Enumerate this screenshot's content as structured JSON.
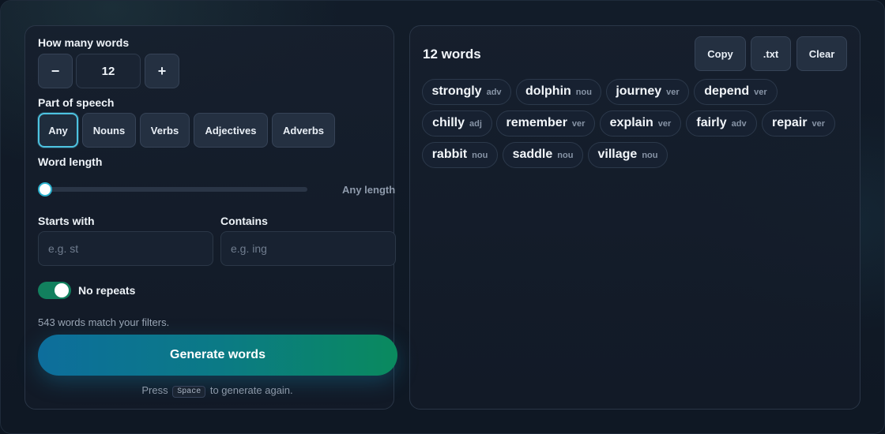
{
  "count_control": {
    "label": "How many words",
    "value": "12",
    "minus_label": "−",
    "plus_label": "+"
  },
  "part_of_speech": {
    "label": "Part of speech",
    "options": [
      "Any",
      "Nouns",
      "Verbs",
      "Adjectives",
      "Adverbs"
    ],
    "selected": "Any"
  },
  "word_length": {
    "label": "Word length",
    "value_text": "Any length",
    "level": 0
  },
  "filters": {
    "starts_with_label": "Starts with",
    "starts_with_placeholder": "e.g. st",
    "starts_with_value": "",
    "contains_label": "Contains",
    "contains_placeholder": "e.g. ing",
    "contains_value": ""
  },
  "no_repeats": {
    "label": "No repeats",
    "on": true
  },
  "match_text": "543 words match your filters.",
  "generate_label": "Generate words",
  "hint": {
    "before": "Press",
    "key": "Space",
    "after": "to generate again."
  },
  "output": {
    "count_title": "12 words",
    "copy_label": "Copy",
    "txt_label": ".txt",
    "clear_label": "Clear",
    "words": [
      {
        "word": "strongly",
        "pos": "adv"
      },
      {
        "word": "dolphin",
        "pos": "nou"
      },
      {
        "word": "journey",
        "pos": "ver"
      },
      {
        "word": "depend",
        "pos": "ver"
      },
      {
        "word": "chilly",
        "pos": "adj"
      },
      {
        "word": "remember",
        "pos": "ver"
      },
      {
        "word": "explain",
        "pos": "ver"
      },
      {
        "word": "fairly",
        "pos": "adv"
      },
      {
        "word": "repair",
        "pos": "ver"
      },
      {
        "word": "rabbit",
        "pos": "nou"
      },
      {
        "word": "saddle",
        "pos": "nou"
      },
      {
        "word": "village",
        "pos": "nou"
      }
    ]
  },
  "colors": {
    "accent": "#4ec3e0",
    "toggle_on": "#12805e",
    "generate_start": "#0d6e9c",
    "generate_end": "#0a8a5e"
  }
}
